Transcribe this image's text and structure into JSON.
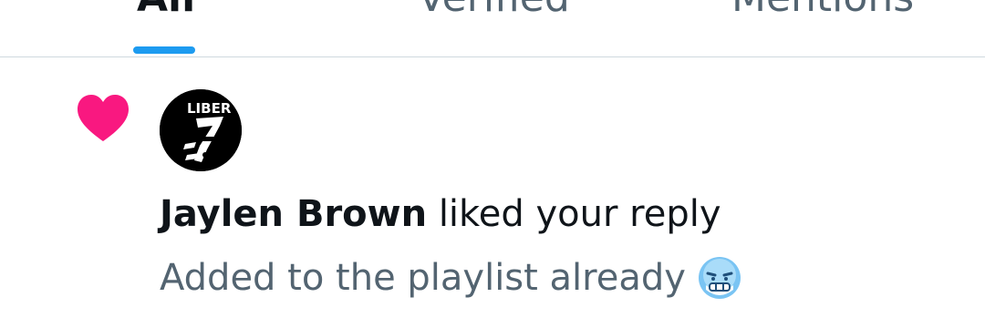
{
  "tabs": [
    {
      "label": "All",
      "active": true
    },
    {
      "label": "Verified",
      "active": false
    },
    {
      "label": "Mentions",
      "active": false
    }
  ],
  "notification": {
    "type_icon": "heart-icon",
    "type_color": "#f91880",
    "avatar_text": "LIBER",
    "actor": "Jaylen Brown",
    "action": "liked your reply",
    "snippet": "Added to the playlist already",
    "emoji": "cold-face-emoji-icon"
  },
  "colors": {
    "accent": "#1d9bf0",
    "primary_text": "#0f1419",
    "secondary_text": "#536471",
    "divider": "#cfd9de"
  }
}
